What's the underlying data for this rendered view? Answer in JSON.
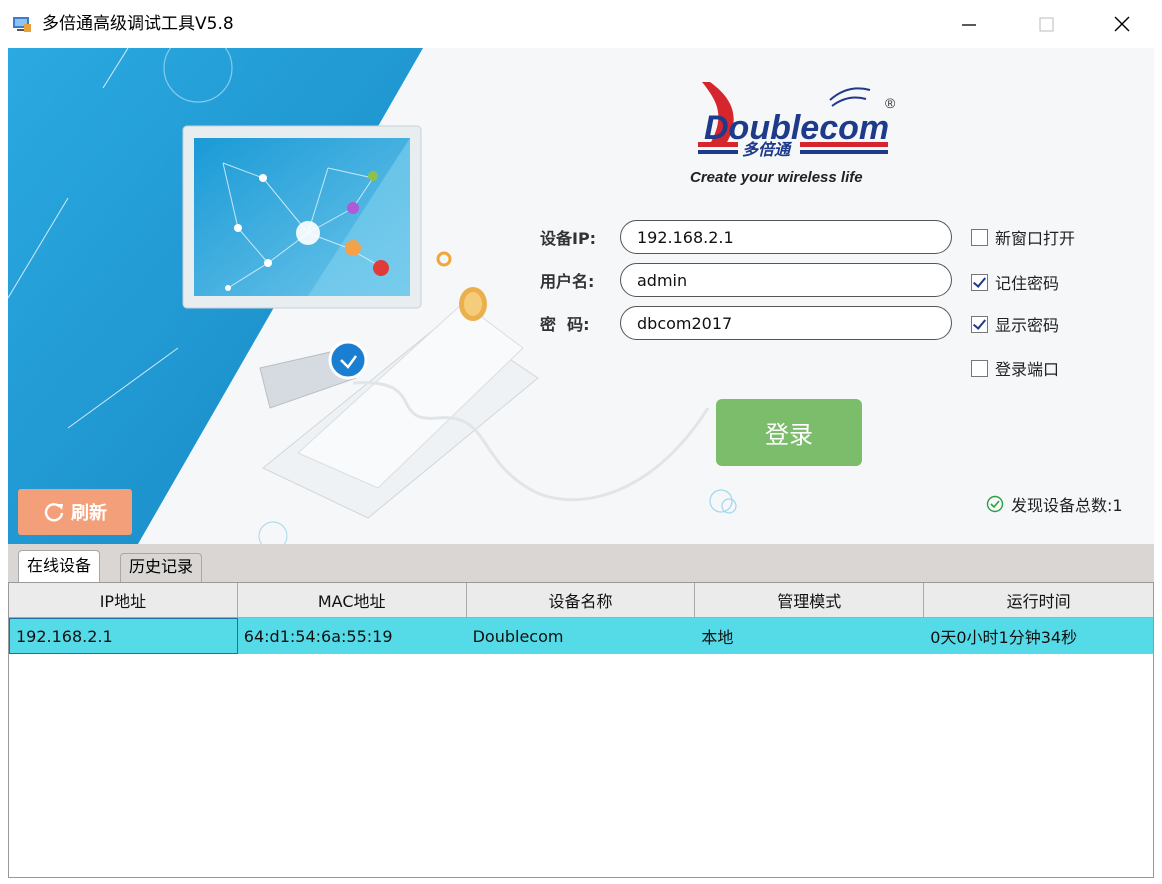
{
  "window": {
    "title": "多倍通高级调试工具V5.8"
  },
  "logo": {
    "brand": "Doublecom",
    "brand_cn": "多倍通",
    "slogan": "Create your wireless life",
    "registered": "®"
  },
  "form": {
    "ip_label": "设备IP:",
    "ip_value": "192.168.2.1",
    "user_label": "用户名:",
    "user_value": "admin",
    "pass_label": "密  码:",
    "pass_value": "dbcom2017"
  },
  "options": {
    "new_window": {
      "label": "新窗口打开",
      "checked": false
    },
    "remember": {
      "label": "记住密码",
      "checked": true
    },
    "show_password": {
      "label": "显示密码",
      "checked": true
    },
    "login_port": {
      "label": "登录端口",
      "checked": false
    }
  },
  "buttons": {
    "login": "登录",
    "refresh": "刷新"
  },
  "status": {
    "found_devices": "发现设备总数:1"
  },
  "tabs": [
    {
      "label": "在线设备",
      "active": true
    },
    {
      "label": "历史记录",
      "active": false
    }
  ],
  "table": {
    "columns": [
      "IP地址",
      "MAC地址",
      "设备名称",
      "管理模式",
      "运行时间"
    ],
    "rows": [
      [
        "192.168.2.1",
        "64:d1:54:6a:55:19",
        "Doublecom",
        "本地",
        "0天0小时1分钟34秒"
      ]
    ]
  },
  "colors": {
    "accent_blue": "#1aa3d9",
    "login_green": "#7cbd6c",
    "refresh_orange": "#f3a07a",
    "selected_row": "#55dbe8",
    "brand_red": "#d4262c",
    "brand_navy": "#1e3a8a"
  }
}
